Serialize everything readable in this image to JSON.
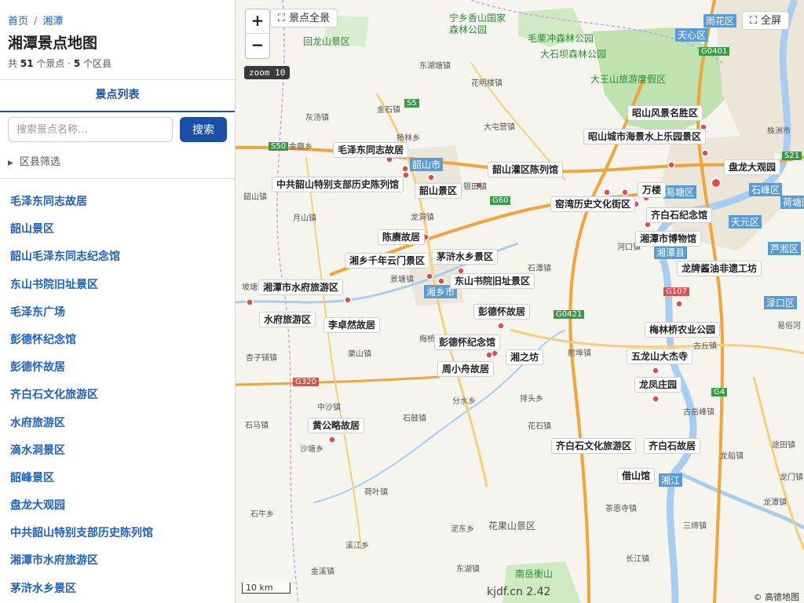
{
  "sidebar": {
    "breadcrumb": {
      "home": "首页",
      "separator": "/",
      "current": "湘潭"
    },
    "title": "湘潭景点地图",
    "summary": {
      "prefix": "共",
      "spot_count": "51",
      "mid": "个景点 ·",
      "district_count": "5",
      "suffix": "个区县"
    },
    "tab_label": "景点列表",
    "search": {
      "placeholder": "搜索景点名称…",
      "button": "搜索"
    },
    "filter_label": "区县筛选",
    "items": [
      "毛泽东同志故居",
      "韶山景区",
      "韶山毛泽东同志纪念馆",
      "东山书院旧址景区",
      "毛泽东广场",
      "彭德怀纪念馆",
      "彭德怀故居",
      "齐白石文化旅游区",
      "水府旅游区",
      "滴水洞景区",
      "韶峰景区",
      "盘龙大观园",
      "中共韶山特别支部历史陈列馆",
      "湘潭市水府旅游区",
      "茅浒水乡景区"
    ]
  },
  "map": {
    "zoom_in": "+",
    "zoom_out": "−",
    "panorama_button": "景点全景",
    "fullscreen_button": "全屏",
    "zoom_level": "zoom 10",
    "scale": "10 km",
    "watermark": "kjdf.cn 2.42",
    "copyright": "© 高德地图",
    "colors": {
      "water": "#a9cdf0",
      "forest": "#bfe2b0",
      "expressway": "#f2a33a",
      "road": "#f6cf7a",
      "urban": "#ece6d8",
      "marker": "#e14b4b"
    },
    "icons": {
      "panorama": "expand-icon",
      "fullscreen": "fullscreen-icon"
    },
    "pois": [
      "昭山风景名胜区",
      "昭山城市海景水上乐园景区",
      "毛泽东同志故居",
      "韶山灌区陈列馆",
      "盘龙大观园",
      "中共韶山特别支部历史陈列馆",
      "韶山景区",
      "万楼",
      "窑湾历史文化街区",
      "齐白石纪念馆",
      "陈赓故居",
      "湘潭市博物馆",
      "湘乡千年云门景区",
      "茅浒水乡景区",
      "龙牌酱油非遗工坊",
      "湘潭市水府旅游区",
      "东山书院旧址景区",
      "水府旅游区",
      "李卓然故居",
      "彭德怀故居",
      "梅林桥农业公园",
      "彭德怀纪念馆",
      "湘之坊",
      "五龙山大杰寺",
      "周小舟故居",
      "龙凤庄园",
      "黄公略故居",
      "齐白石文化旅游区",
      "齐白石故居",
      "借山馆"
    ],
    "places": [
      "宁乡香山国家森林公园",
      "毛栗冲森林公园",
      "大石坝森林公园",
      "大王山旅游度假区",
      "回龙山景区",
      "东湖塘镇",
      "花明楼镇",
      "金石镇",
      "灰汤镇",
      "大屯营镇",
      "杨林乡",
      "金鹿乡",
      "韶山市",
      "银田镇",
      "月山镇",
      "龙洞镇",
      "石潭镇",
      "河口镇",
      "湘乡市",
      "景塘镇",
      "杏子铺镇",
      "栗山镇",
      "梅桥镇",
      "射埠镇",
      "中沙镇",
      "石鼓镇",
      "分水乡",
      "花石镇",
      "排头乡",
      "石马镇",
      "古丘镇",
      "古岳峰镇",
      "沙塘乡",
      "荷叶镇",
      "茶恩寺镇",
      "石牛乡",
      "泥东乡",
      "花果山景区",
      "溪江乡",
      "金溪镇",
      "东湖镇",
      "长江镇",
      "三缔镇",
      "南岳衡山",
      "雨花区",
      "天心区",
      "株洲市",
      "株洲",
      "易塘区",
      "石峰区",
      "荷塘区",
      "天元区",
      "芦淞区",
      "渌口区",
      "湘潭县",
      "湘江",
      "龙船镇",
      "途田镇",
      "龙门镇",
      "龙潭镇",
      "坡塘镇",
      "韶山镇",
      "易俗河",
      "S50",
      "S5",
      "G60",
      "G0401",
      "S21",
      "G107",
      "G0421",
      "G320",
      "G4"
    ]
  }
}
